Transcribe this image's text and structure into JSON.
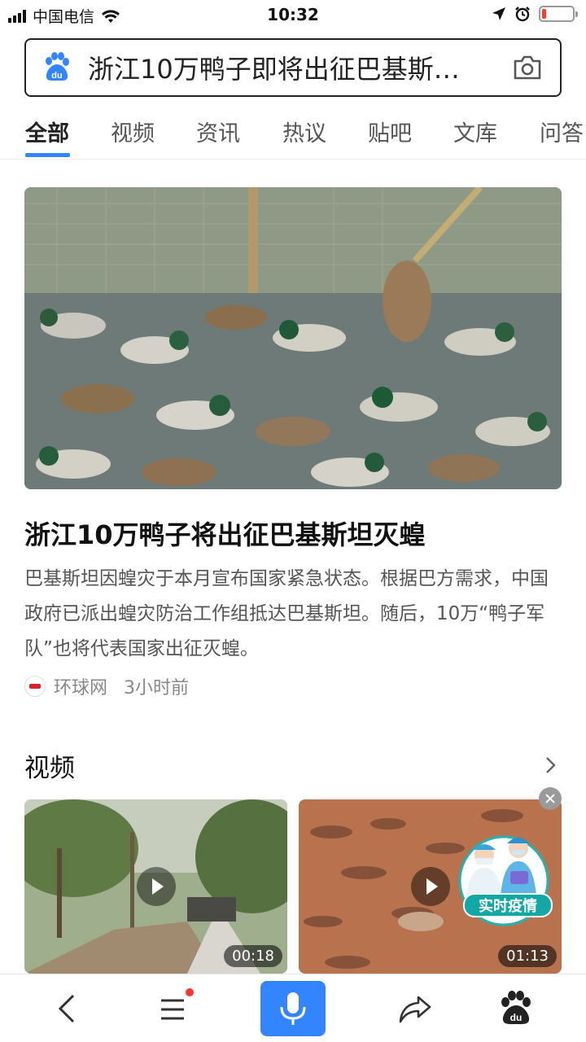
{
  "status_bar": {
    "carrier": "中国电信",
    "time": "10:32",
    "battery_level": 0.15
  },
  "search": {
    "query": "浙江10万鸭子即将出征巴基斯…",
    "logo_text": "du"
  },
  "tabs": [
    {
      "label": "全部",
      "active": true
    },
    {
      "label": "视频"
    },
    {
      "label": "资讯"
    },
    {
      "label": "热议"
    },
    {
      "label": "贴吧"
    },
    {
      "label": "文库"
    },
    {
      "label": "问答"
    }
  ],
  "article": {
    "title": "浙江10万鸭子将出征巴基斯坦灭蝗",
    "summary": "巴基斯坦因蝗灾于本月宣布国家紧急状态。根据巴方需求，中国政府已派出蝗灾防治工作组抵达巴基斯坦。随后，10万“鸭子军队”也将代表国家出征灭蝗。",
    "source": "环球网",
    "time": "3小时前"
  },
  "videos": {
    "section_title": "视频",
    "items": [
      {
        "duration": "00:18"
      },
      {
        "duration": "01:13"
      }
    ],
    "promo_label": "实时疫情"
  },
  "colors": {
    "accent": "#3385ff",
    "text_primary": "#222222",
    "text_secondary": "#555555",
    "text_meta": "#888888"
  },
  "icons": [
    "signal-icon",
    "wifi-icon",
    "location-icon",
    "alarm-icon",
    "battery-icon",
    "baidu-paw-icon",
    "camera-icon",
    "chevron-right-icon",
    "play-icon",
    "close-icon",
    "back-icon",
    "menu-icon",
    "mic-icon",
    "share-icon",
    "baidu-home-icon"
  ]
}
